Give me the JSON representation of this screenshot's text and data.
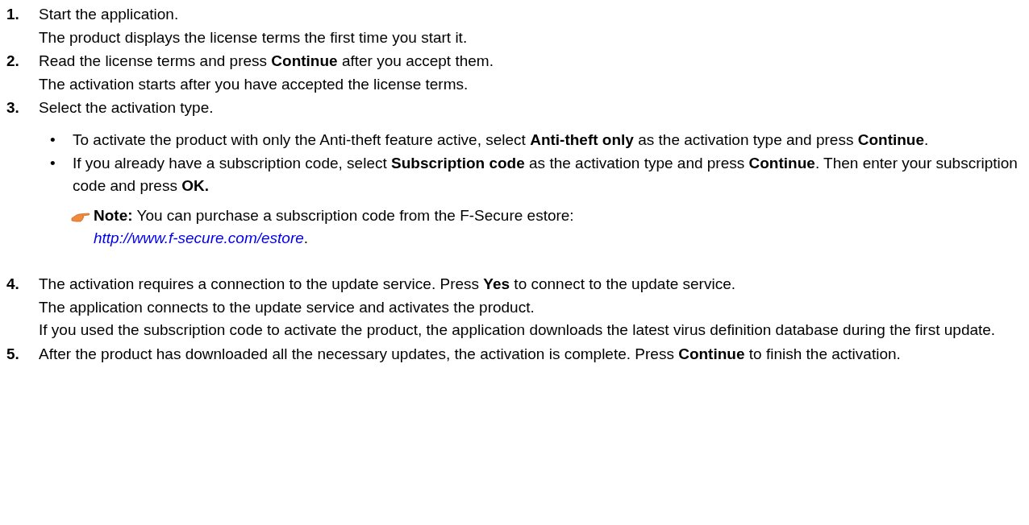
{
  "steps": [
    {
      "number": "1.",
      "lines": [
        "Start the application.",
        "The product displays the license terms the first time you start it."
      ]
    },
    {
      "number": "2.",
      "lines": [
        "Read the license terms and press **Continue** after you accept them.",
        "The activation starts after you have accepted the license terms."
      ]
    },
    {
      "number": "3.",
      "lines": [
        "Select the activation type."
      ],
      "bullets": [
        {
          "bullet": "•",
          "text": "To activate the product with only the Anti-theft feature active, select **Anti-theft only** as the activation type and press **Continue**."
        },
        {
          "bullet": "•",
          "text": "If you already have a subscription code, select **Subscription code** as the activation type and press **Continue**. Then enter your subscription code and press **OK.**"
        }
      ],
      "note": {
        "text": "**Note:**  You can purchase a subscription code from the F-Secure estore:",
        "link": "http://www.f-secure.com/estore",
        "suffix": "."
      }
    },
    {
      "number": "4.",
      "lines": [
        "The activation requires a connection to the update service. Press **Yes** to connect to the update service.",
        "The application connects to the update service and activates the product.",
        "If you used the subscription code to activate the product, the application downloads the latest virus definition database during the first update."
      ]
    },
    {
      "number": "5.",
      "lines": [
        "After the product has downloaded all the necessary updates, the activation is complete. Press **Continue** to finish the activation."
      ]
    }
  ]
}
